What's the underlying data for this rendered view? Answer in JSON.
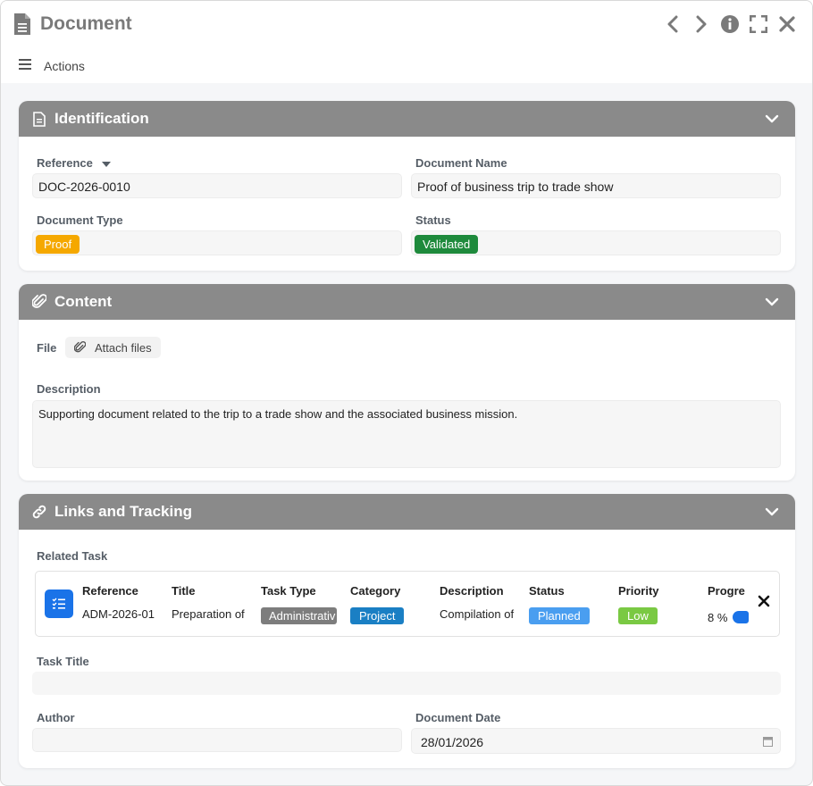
{
  "header": {
    "title": "Document",
    "actions_label": "Actions",
    "controls": [
      "chevron-left-icon",
      "chevron-right-icon",
      "info-icon",
      "fullscreen-icon",
      "close-icon"
    ]
  },
  "identification": {
    "title": "Identification",
    "reference_label": "Reference",
    "reference_value": "DOC-2026-0010",
    "name_label": "Document Name",
    "name_value": "Proof of business trip to trade show",
    "type_label": "Document Type",
    "type_value": "Proof",
    "status_label": "Status",
    "status_value": "Validated"
  },
  "content": {
    "title": "Content",
    "file_label": "File",
    "attach_label": "Attach files",
    "description_label": "Description",
    "description_value": "Supporting document related to the trip to a trade show and the associated business mission."
  },
  "links": {
    "title": "Links and Tracking",
    "related_task_label": "Related Task",
    "table": {
      "headers": [
        "Reference",
        "Title",
        "Task Type",
        "Category",
        "Description",
        "Status",
        "Priority",
        "Progre"
      ],
      "row": {
        "reference": "ADM-2026-01",
        "title": "Preparation of",
        "task_type": "Administrativ",
        "category": "Project",
        "description": "Compilation of",
        "status": "Planned",
        "priority": "Low",
        "progress_text": "8 %"
      }
    },
    "task_title_label": "Task Title",
    "task_title_value": "",
    "author_label": "Author",
    "author_value": "",
    "date_label": "Document Date",
    "date_value": "28/01/2026"
  },
  "colors": {
    "panel_header": "#8a8a8a",
    "proof_badge": "#f5a800",
    "validated_badge": "#1e8a3c",
    "task_type_badge": "#7d7d7d",
    "project_badge": "#1a7fc4",
    "planned_badge": "#4a9ef0",
    "low_badge": "#7ac943",
    "accent_blue": "#1a73e8"
  }
}
